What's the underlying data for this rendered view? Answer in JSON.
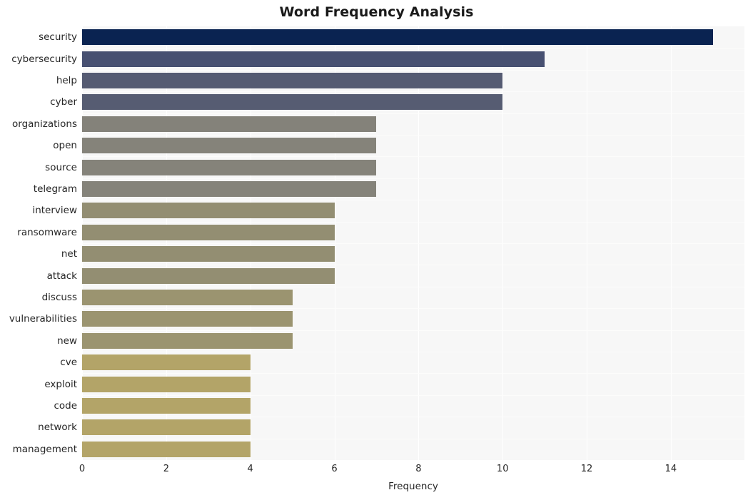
{
  "chart_data": {
    "type": "bar",
    "orientation": "horizontal",
    "title": "Word Frequency Analysis",
    "xlabel": "Frequency",
    "ylabel": "",
    "categories": [
      "security",
      "cybersecurity",
      "help",
      "cyber",
      "organizations",
      "open",
      "source",
      "telegram",
      "interview",
      "ransomware",
      "net",
      "attack",
      "discuss",
      "vulnerabilities",
      "new",
      "cve",
      "exploit",
      "code",
      "network",
      "management"
    ],
    "values": [
      15,
      11,
      10,
      10,
      7,
      7,
      7,
      7,
      6,
      6,
      6,
      6,
      5,
      5,
      5,
      4,
      4,
      4,
      4,
      4
    ],
    "bar_colors": [
      "#0a2351",
      "#475071",
      "#555b72",
      "#565c72",
      "#84827a",
      "#85837a",
      "#85837a",
      "#85837a",
      "#938e72",
      "#938e72",
      "#938e72",
      "#938e72",
      "#9b9470",
      "#9b9470",
      "#9b9470",
      "#b3a468",
      "#b3a468",
      "#b3a468",
      "#b3a468",
      "#b3a468"
    ],
    "xlim": [
      0,
      15.75
    ],
    "xticks": [
      0,
      2,
      4,
      6,
      8,
      10,
      12,
      14
    ],
    "xtick_labels": [
      "0",
      "2",
      "4",
      "6",
      "8",
      "10",
      "12",
      "14"
    ],
    "grid": true,
    "grid_axis": "x",
    "legend": false,
    "plot_background": "#f7f7f7",
    "figure_background": "#ffffff",
    "gridline_color": "#ffffff",
    "title_color": "#1a1a1a",
    "tick_color": "#262626"
  }
}
